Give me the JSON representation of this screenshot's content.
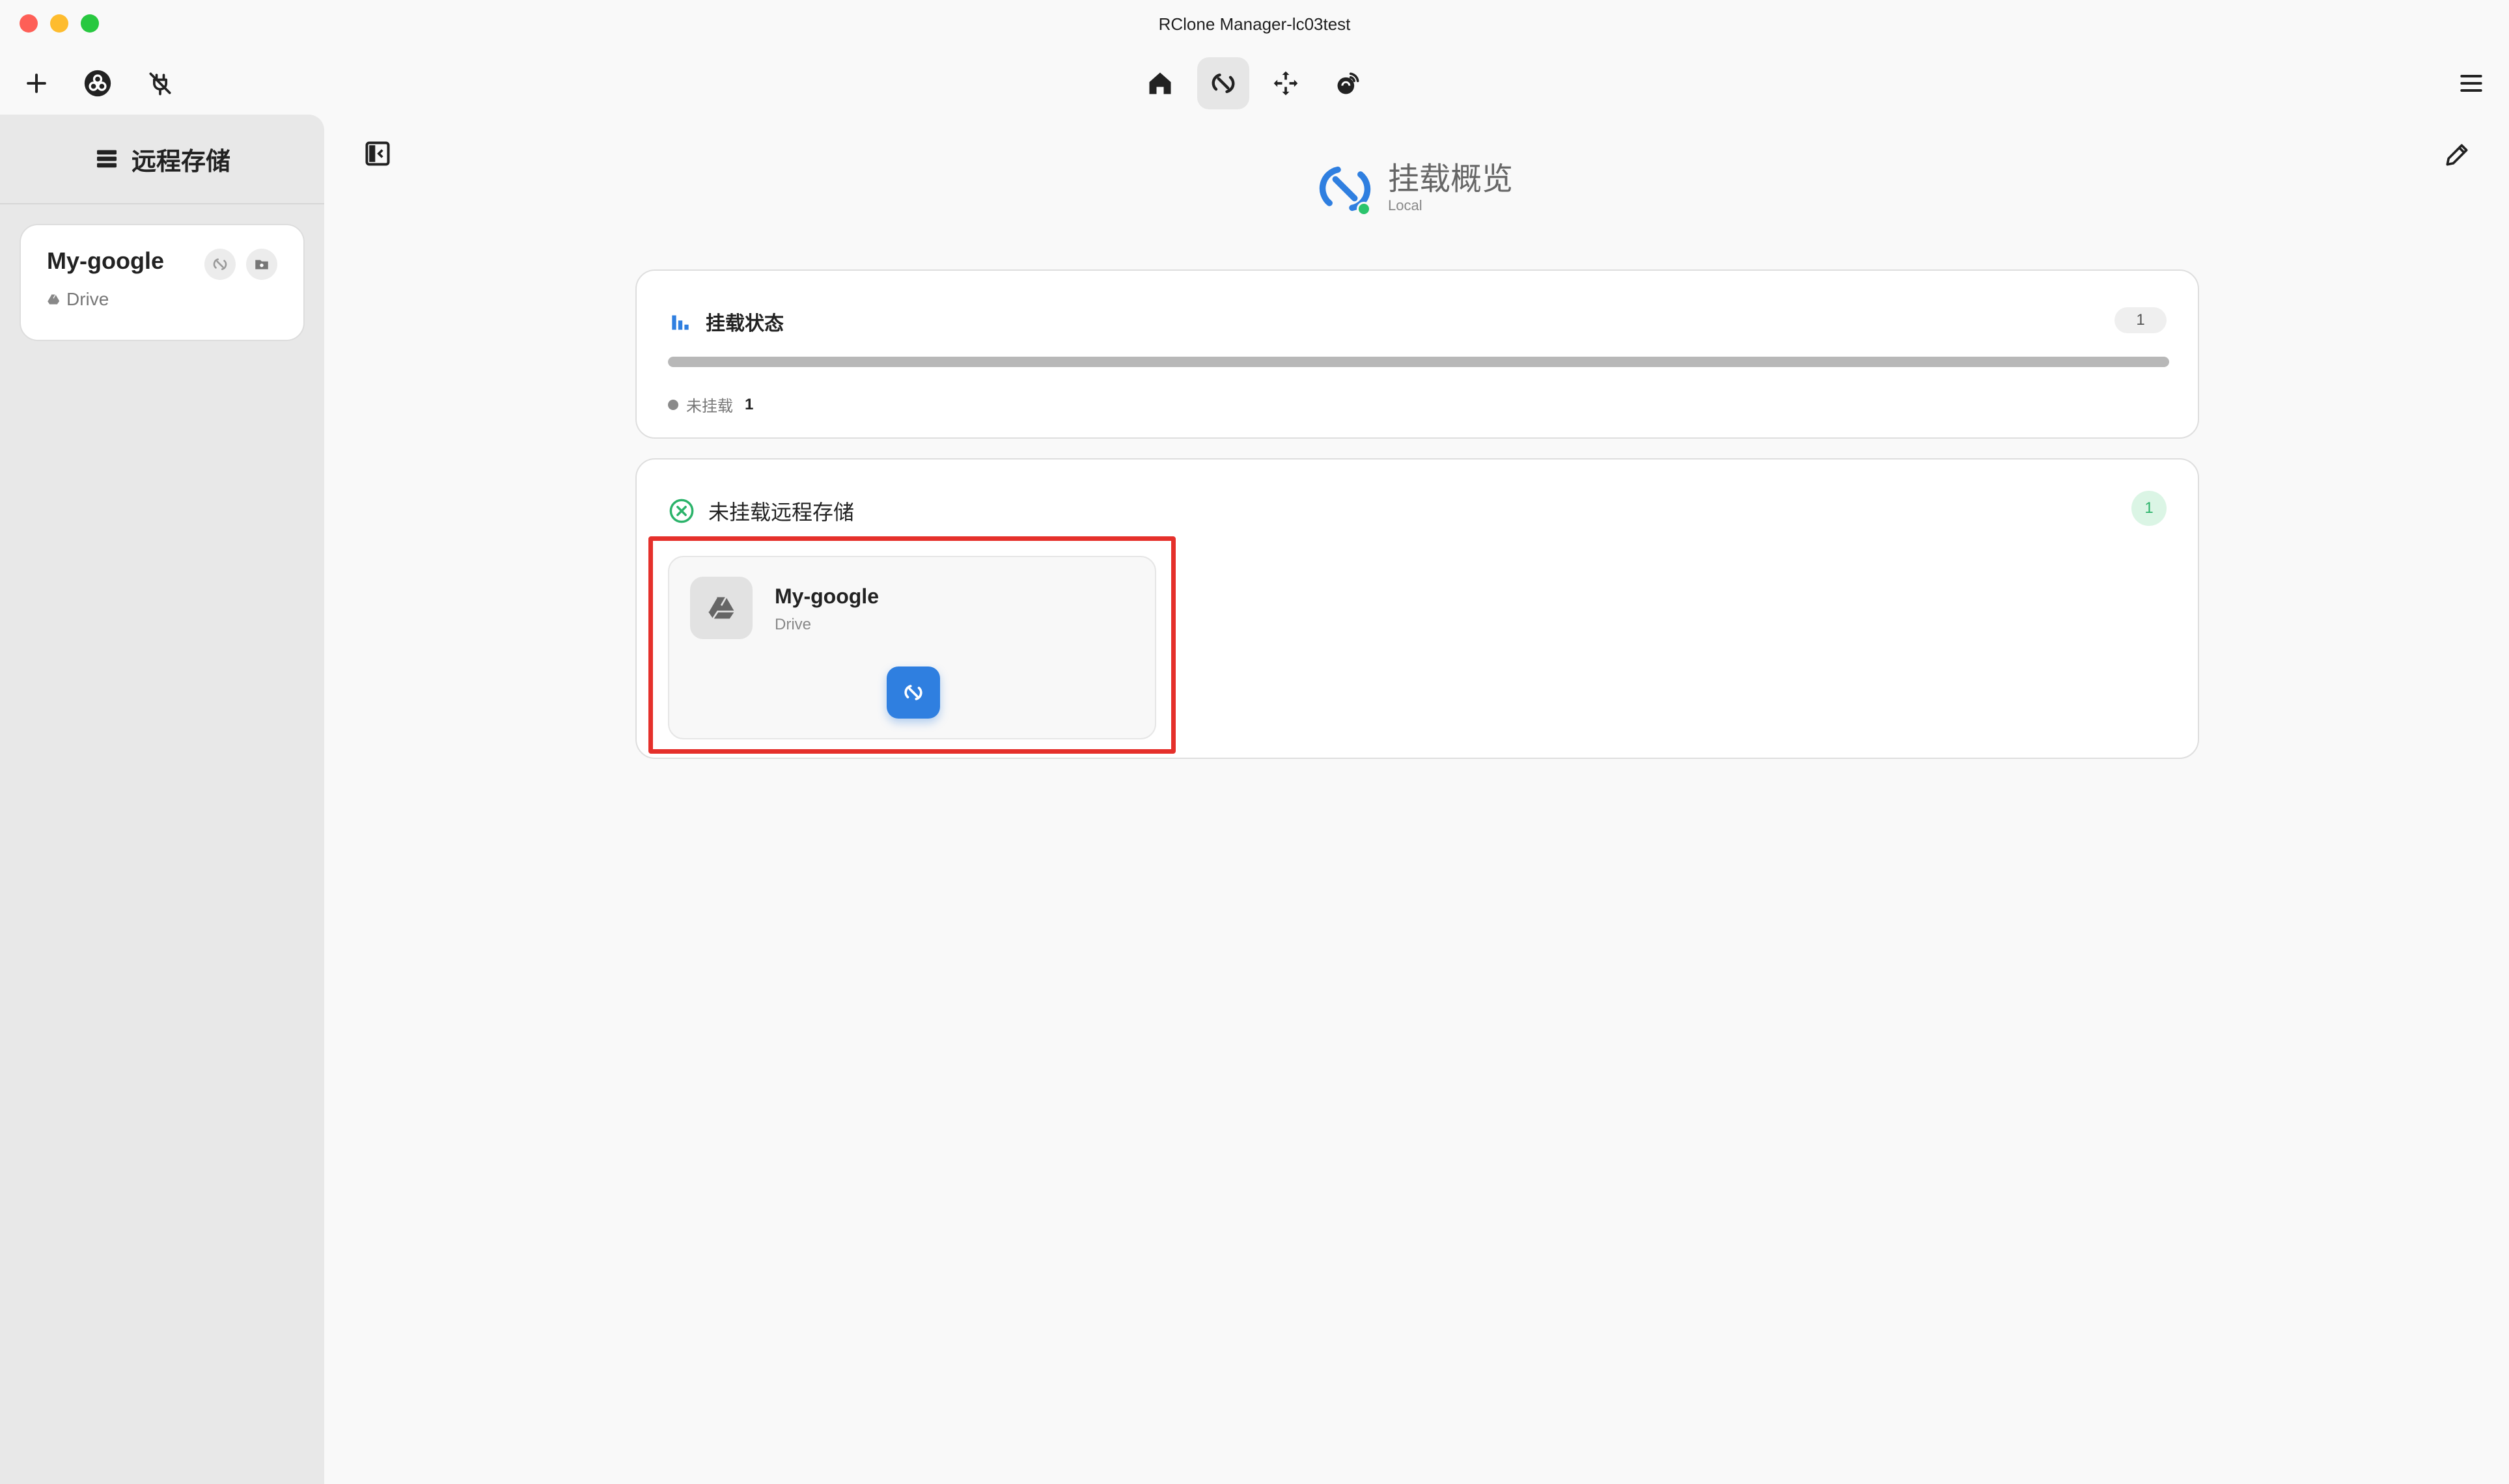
{
  "window": {
    "title": "RClone Manager-lc03test"
  },
  "toolbar": {
    "left_icons": [
      "plus-icon",
      "rclone-logo-icon",
      "unplug-icon"
    ],
    "center_tabs": [
      {
        "icon": "home-icon",
        "active": false
      },
      {
        "icon": "mount-link-icon",
        "active": true
      },
      {
        "icon": "sync-arrows-icon",
        "active": false
      },
      {
        "icon": "serve-broadcast-icon",
        "active": false
      }
    ],
    "right_icons": [
      "menu-icon"
    ]
  },
  "sidebar": {
    "title": "远程存储",
    "remotes": [
      {
        "name": "My-google",
        "type": "Drive"
      }
    ]
  },
  "main": {
    "title": "挂载概览",
    "subtitle": "Local",
    "status_panel": {
      "label": "挂载状态",
      "count": "1",
      "progress_fraction_unmounted": 1.0,
      "legend": [
        {
          "label": "未挂载",
          "value": "1",
          "color": "#8a8a8a"
        }
      ]
    },
    "unmounted_panel": {
      "label": "未挂载远程存储",
      "count": "1",
      "remotes": [
        {
          "name": "My-google",
          "type": "Drive"
        }
      ]
    }
  },
  "colors": {
    "accent": "#2f7fe0",
    "status_green": "#2bc46d",
    "highlight": "#e5302b"
  }
}
